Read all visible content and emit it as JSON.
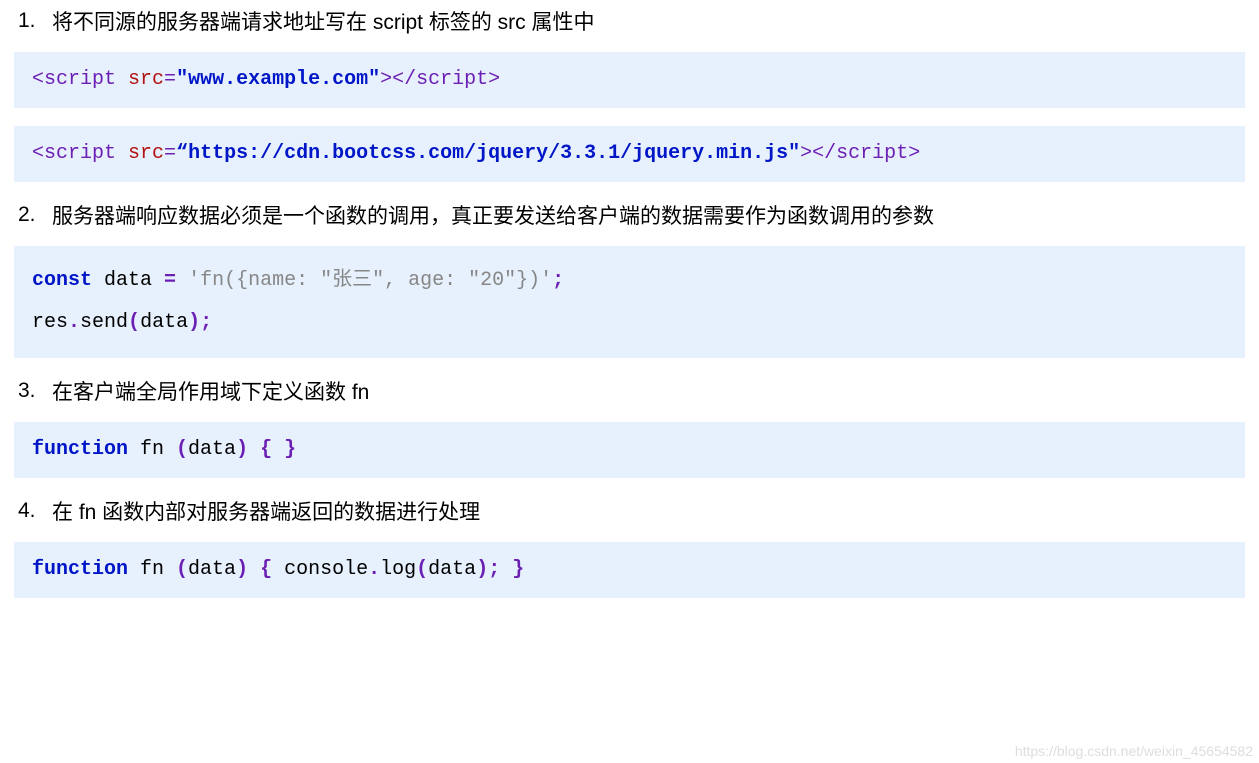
{
  "steps": [
    {
      "num": "1.",
      "text": "将不同源的服务器端请求地址写在 script 标签的 src 属性中",
      "codes": [
        {
          "tokens": [
            {
              "cls": "t-tag",
              "txt": "<script"
            },
            {
              "cls": "",
              "txt": " "
            },
            {
              "cls": "t-attr",
              "txt": "src"
            },
            {
              "cls": "t-tag",
              "txt": "="
            },
            {
              "cls": "t-str",
              "txt": "\"www.example.com\""
            },
            {
              "cls": "t-tag",
              "txt": "></script>"
            }
          ]
        },
        {
          "tokens": [
            {
              "cls": "t-tag",
              "txt": "<script"
            },
            {
              "cls": "",
              "txt": " "
            },
            {
              "cls": "t-attr",
              "txt": "src"
            },
            {
              "cls": "t-tag",
              "txt": "="
            },
            {
              "cls": "t-str",
              "txt": "“https://cdn.bootcss.com/jquery/3.3.1/jquery.min.js\""
            },
            {
              "cls": "t-tag",
              "txt": "></script>"
            }
          ]
        }
      ]
    },
    {
      "num": "2.",
      "text": "服务器端响应数据必须是一个函数的调用，真正要发送给客户端的数据需要作为函数调用的参数",
      "codes": [
        {
          "tokens": [
            {
              "cls": "t-kw",
              "txt": "const"
            },
            {
              "cls": "",
              "txt": " data "
            },
            {
              "cls": "t-punct",
              "txt": "="
            },
            {
              "cls": "",
              "txt": " "
            },
            {
              "cls": "t-gray",
              "txt": "'fn({name: \"张三\", age: \"20\"})'"
            },
            {
              "cls": "t-punct",
              "txt": ";"
            },
            {
              "cls": "",
              "txt": "\nres"
            },
            {
              "cls": "t-punct",
              "txt": "."
            },
            {
              "cls": "",
              "txt": "send"
            },
            {
              "cls": "t-punct",
              "txt": "("
            },
            {
              "cls": "",
              "txt": "data"
            },
            {
              "cls": "t-punct",
              "txt": ");"
            }
          ]
        }
      ]
    },
    {
      "num": "3.",
      "text": "在客户端全局作用域下定义函数 fn",
      "codes": [
        {
          "tokens": [
            {
              "cls": "t-kw",
              "txt": "function"
            },
            {
              "cls": "",
              "txt": " fn "
            },
            {
              "cls": "t-punct",
              "txt": "("
            },
            {
              "cls": "",
              "txt": "data"
            },
            {
              "cls": "t-punct",
              "txt": ")"
            },
            {
              "cls": "",
              "txt": " "
            },
            {
              "cls": "t-punct",
              "txt": "{"
            },
            {
              "cls": "",
              "txt": " "
            },
            {
              "cls": "t-punct",
              "txt": "}"
            }
          ]
        }
      ]
    },
    {
      "num": "4.",
      "text": "在 fn 函数内部对服务器端返回的数据进行处理",
      "codes": [
        {
          "tokens": [
            {
              "cls": "t-kw",
              "txt": "function"
            },
            {
              "cls": "",
              "txt": " fn "
            },
            {
              "cls": "t-punct",
              "txt": "("
            },
            {
              "cls": "",
              "txt": "data"
            },
            {
              "cls": "t-punct",
              "txt": ")"
            },
            {
              "cls": "",
              "txt": " "
            },
            {
              "cls": "t-punct",
              "txt": "{"
            },
            {
              "cls": "",
              "txt": " console"
            },
            {
              "cls": "t-punct",
              "txt": "."
            },
            {
              "cls": "",
              "txt": "log"
            },
            {
              "cls": "t-punct",
              "txt": "("
            },
            {
              "cls": "",
              "txt": "data"
            },
            {
              "cls": "t-punct",
              "txt": ");"
            },
            {
              "cls": "",
              "txt": " "
            },
            {
              "cls": "t-punct",
              "txt": "}"
            }
          ]
        }
      ]
    }
  ],
  "watermark": "https://blog.csdn.net/weixin_45654582"
}
